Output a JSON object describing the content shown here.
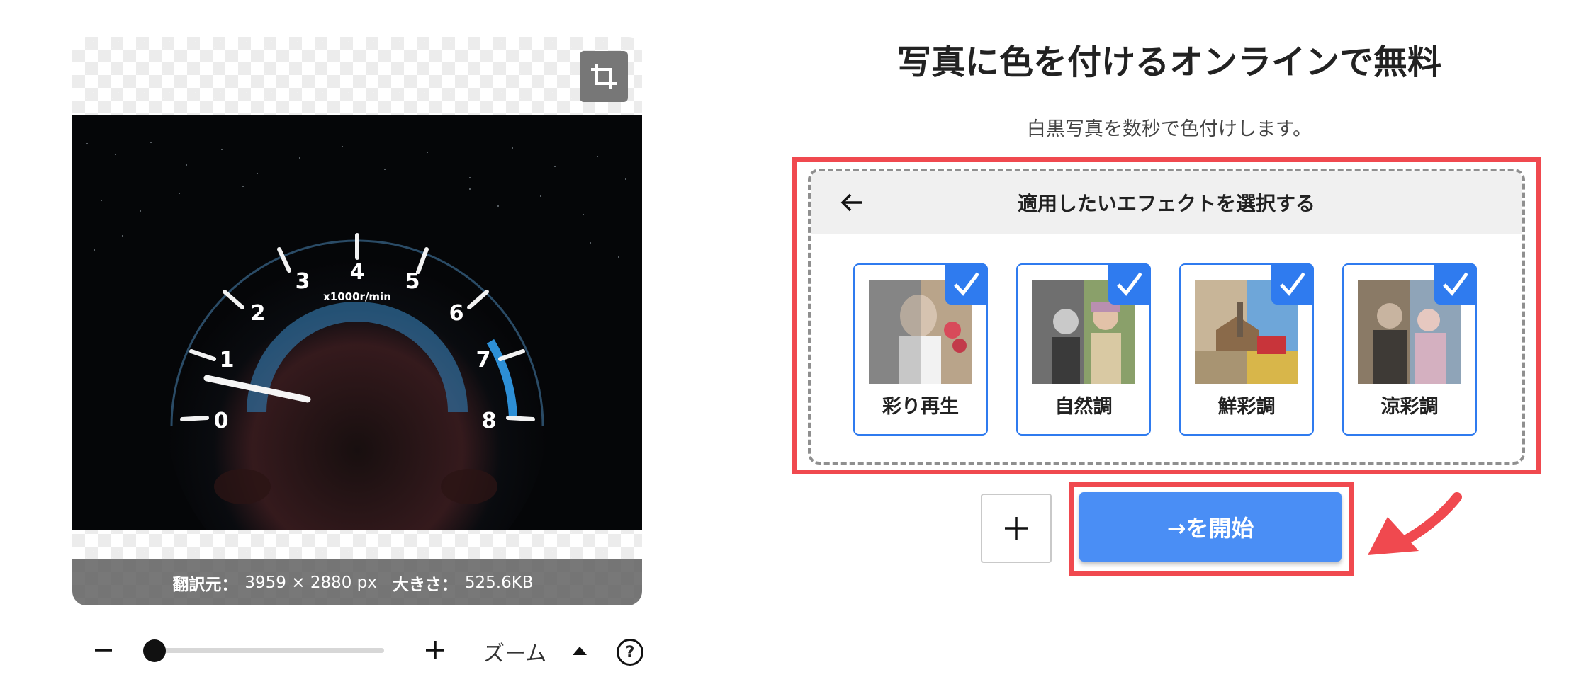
{
  "preview": {
    "info": {
      "source_label": "翻訳元：",
      "source_value": "3959 × 2880 px",
      "size_label": "大きさ：",
      "size_value": "525.6KB"
    },
    "gauge_numbers": [
      "0",
      "1",
      "2",
      "3",
      "4",
      "5",
      "6",
      "7",
      "8"
    ],
    "gauge_unit": "x1000r/min"
  },
  "zoom": {
    "label": "ズーム",
    "level": 0
  },
  "help": {
    "symbol": "?"
  },
  "page": {
    "title": "写真に色を付けるオンラインで無料",
    "subtitle": "白黒写真を数秒で色付けします。"
  },
  "effects": {
    "title": "適用したいエフェクトを選択する",
    "items": [
      {
        "label": "彩り再生",
        "checked": true
      },
      {
        "label": "自然調",
        "checked": true
      },
      {
        "label": "鮮彩調",
        "checked": true
      },
      {
        "label": "涼彩調",
        "checked": true
      }
    ]
  },
  "actions": {
    "add": "+",
    "start": "→を開始"
  },
  "colors": {
    "accent": "#2f7bef",
    "button": "#4a8ef5",
    "highlight": "#f0494f"
  }
}
